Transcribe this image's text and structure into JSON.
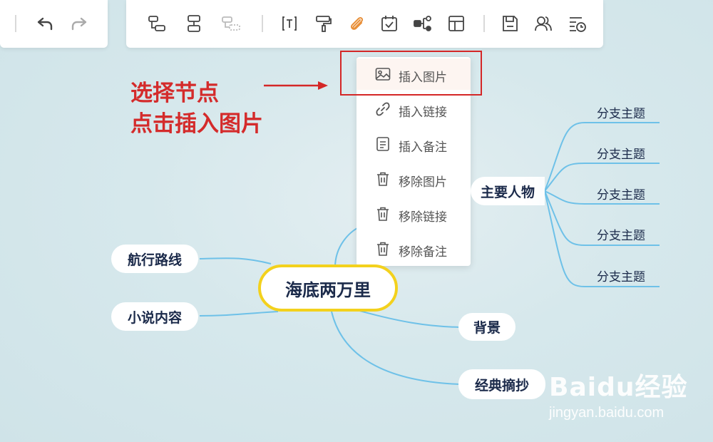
{
  "toolbar": {
    "left": [
      {
        "name": "undo-icon"
      },
      {
        "name": "redo-icon"
      }
    ],
    "main": [
      {
        "name": "insert-child-topic-icon"
      },
      {
        "name": "insert-sibling-topic-icon"
      },
      {
        "name": "insert-floating-topic-icon"
      },
      {
        "name": "text-format-icon"
      },
      {
        "name": "format-painter-icon"
      },
      {
        "name": "attachment-icon",
        "active": true,
        "color": "#e8903a"
      },
      {
        "name": "task-checkbox-icon"
      },
      {
        "name": "structure-icon"
      },
      {
        "name": "layout-icon"
      },
      {
        "name": "save-icon"
      },
      {
        "name": "collaborators-icon"
      },
      {
        "name": "history-icon"
      }
    ]
  },
  "context_menu": {
    "items": [
      {
        "label": "插入图片",
        "icon": "image-icon",
        "highlighted": true
      },
      {
        "label": "插入链接",
        "icon": "link-icon"
      },
      {
        "label": "插入备注",
        "icon": "note-icon"
      },
      {
        "label": "移除图片",
        "icon": "trash-icon"
      },
      {
        "label": "移除链接",
        "icon": "trash-icon"
      },
      {
        "label": "移除备注",
        "icon": "trash-icon"
      }
    ]
  },
  "annotation": {
    "line1": "选择节点",
    "line2": "点击插入图片",
    "color": "#d42b2b"
  },
  "mindmap": {
    "root": "海底两万里",
    "branches": {
      "main_characters": "主要人物",
      "route": "航行路线",
      "content": "小说内容",
      "background": "背景",
      "excerpts": "经典摘抄"
    },
    "subtopics": [
      "分支主题",
      "分支主题",
      "分支主题",
      "分支主题",
      "分支主题"
    ],
    "line_color": "#6ec1e8",
    "root_border_color": "#f3d11d"
  },
  "watermark": {
    "logo": "Baidu经验",
    "url": "jingyan.baidu.com"
  }
}
